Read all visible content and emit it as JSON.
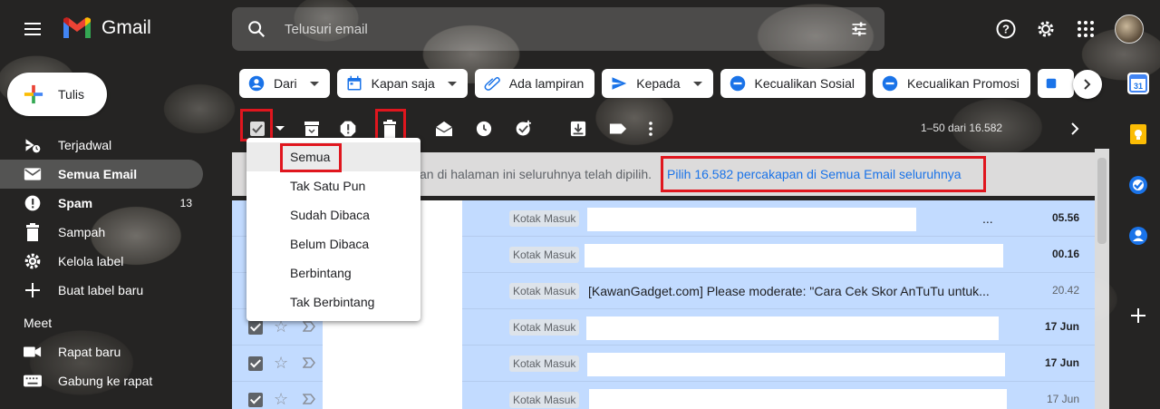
{
  "app": {
    "name": "Gmail"
  },
  "search": {
    "placeholder": "Telusuri email"
  },
  "compose": {
    "label": "Tulis"
  },
  "sidebar": {
    "items": [
      {
        "label": "Terjadwal",
        "icon": "scheduled-icon"
      },
      {
        "label": "Semua Email",
        "icon": "all-mail-icon",
        "active": true
      },
      {
        "label": "Spam",
        "icon": "spam-icon",
        "count": "13"
      },
      {
        "label": "Sampah",
        "icon": "trash-icon"
      },
      {
        "label": "Kelola label",
        "icon": "gear-icon"
      },
      {
        "label": "Buat label baru",
        "icon": "plus-icon"
      }
    ],
    "meet_title": "Meet",
    "meet_items": [
      {
        "label": "Rapat baru",
        "icon": "video-icon"
      },
      {
        "label": "Gabung ke rapat",
        "icon": "keyboard-icon"
      }
    ]
  },
  "chips": [
    {
      "label": "Dari",
      "icon": "person-icon",
      "caret": true
    },
    {
      "label": "Kapan saja",
      "icon": "calendar-icon",
      "caret": true
    },
    {
      "label": "Ada lampiran",
      "icon": "attachment-icon"
    },
    {
      "label": "Kepada",
      "icon": "send-icon",
      "caret": true
    },
    {
      "label": "Kecualikan Sosial",
      "icon": "minus-circle-icon"
    },
    {
      "label": "Kecualikan Promosi",
      "icon": "minus-circle-icon"
    }
  ],
  "toolbar": {
    "pager": "1–50 dari 16.582"
  },
  "banner": {
    "text": "an di halaman ini seluruhnya telah dipilih.",
    "link": "Pilih 16.582 percakapan di Semua Email seluruhnya"
  },
  "dropdown": {
    "items": [
      "Semua",
      "Tak Satu Pun",
      "Sudah Dibaca",
      "Belum Dibaca",
      "Berbintang",
      "Tak Berbintang"
    ]
  },
  "emails": [
    {
      "label": "Kotak Masuk",
      "subject": "",
      "date": "05.56",
      "bold": true,
      "dots": "..."
    },
    {
      "label": "Kotak Masuk",
      "subject": "",
      "date": "00.16",
      "bold": true
    },
    {
      "label": "Kotak Masuk",
      "subject": "[KawanGadget.com] Please moderate: \"Cara Cek Skor AnTuTu untuk...",
      "date": "20.42",
      "bold": false
    },
    {
      "label": "Kotak Masuk",
      "subject": "",
      "date": "17 Jun",
      "bold": true
    },
    {
      "label": "Kotak Masuk",
      "subject": "",
      "date": "17 Jun",
      "bold": true
    },
    {
      "label": "Kotak Masuk",
      "subject": "",
      "date": "17 Jun",
      "bold": false
    }
  ],
  "colors": {
    "accent": "#1a73e8",
    "selected_row": "#c2dbff",
    "highlight": "#e0161e"
  }
}
